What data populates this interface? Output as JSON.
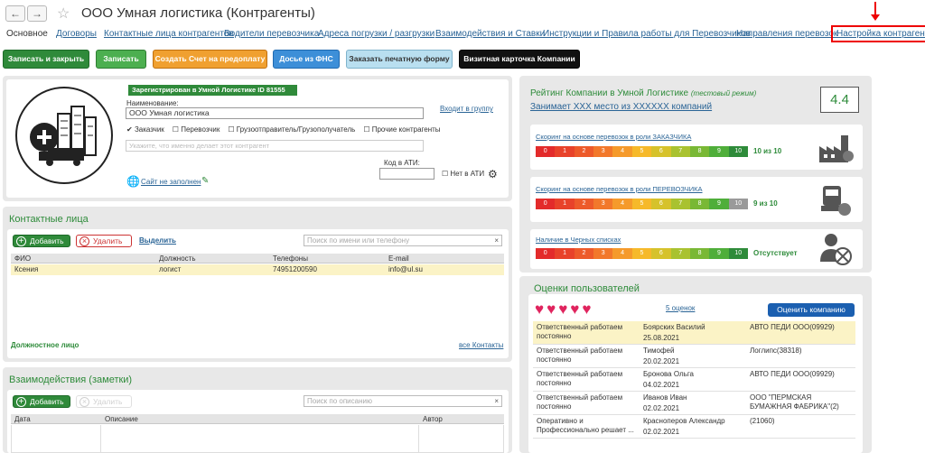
{
  "window": {
    "back": "←",
    "forward": "→",
    "star": "☆",
    "title": "ООО Умная логистика (Контрагенты)"
  },
  "tabs": [
    "Основное",
    "Договоры",
    "Контактные лица контрагентов",
    "Водители перевозчика",
    "Адреса погрузки / разгрузки",
    "Взаимодействия и Ставки",
    "Инструкции и Правила работы для Перевозчиков",
    "Направления перевозок",
    "Настройка контрагента"
  ],
  "toolbar": {
    "save_close": "Записать и закрыть",
    "save": "Записать",
    "create_invoice": "Создать Счет на предоплату",
    "fns_dossier": "Досье из ФНС",
    "print_form": "Заказать печатную форму",
    "business_card": "Визитная карточка Компании"
  },
  "company": {
    "registered": "Зарегистрирован в Умной Логистике   ID 81555",
    "name_label": "Наименование:",
    "name_value": "ООО Умная логистика",
    "join_group": "Входит в группу",
    "roles": [
      "Заказчик",
      "Перевозчик",
      "Грузоотправитель/Грузополучатель",
      "Прочие контрагенты"
    ],
    "note_placeholder": "Укажите, что именно делает этот контрагент",
    "ati_label": "Код в АТИ:",
    "no_ati": "Нет в АТИ",
    "site": "Сайт не заполнен"
  },
  "contacts": {
    "title": "Контактные лица",
    "add": "Добавить",
    "delete": "Удалить",
    "select": "Выделить",
    "search_placeholder": "Поиск по имени или телефону",
    "columns": [
      "ФИО",
      "Должность",
      "Телефоны",
      "E-mail"
    ],
    "rows": [
      {
        "name": "Ксения",
        "position": "логист",
        "phone": "74951200590",
        "email": "info@ul.su"
      }
    ],
    "footer_left": "Должностное лицо",
    "footer_right": "все Контакты"
  },
  "interactions": {
    "title": "Взаимодействия (заметки)",
    "add": "Добавить",
    "delete": "Удалить",
    "search_placeholder": "Поиск по описанию",
    "columns": [
      "Дата",
      "Описание",
      "Автор"
    ]
  },
  "rating": {
    "title": "Рейтинг Компании в Умной Логистике",
    "mode": "(тестовый режим)",
    "place": "Занимает XXX место из XXXXXX компаний",
    "score": "4.4",
    "scale": [
      "0",
      "1",
      "2",
      "3",
      "4",
      "5",
      "6",
      "7",
      "8",
      "9",
      "10"
    ],
    "blocks": [
      {
        "label": "Скоринг на основе перевозок в роли ЗАКАЗЧИКА",
        "result": "10 из 10",
        "level": 10
      },
      {
        "label": "Скоринг на основе перевозок в роли ПЕРЕВОЗЧИКА",
        "result": "9 из 10",
        "level": 9
      },
      {
        "label": "Наличие в Черных списках",
        "result": "Отсутствует",
        "level": 10
      }
    ]
  },
  "reviews": {
    "title": "Оценки пользователей",
    "count": "5 оценок",
    "rate_button": "Оценить компанию",
    "rows": [
      {
        "text": "Ответственный работаем постоянно",
        "author": "Боярских Василий",
        "date": "25.08.2021",
        "company": "АВТО ПЕДИ ООО(09929)"
      },
      {
        "text": "Ответственный работаем постоянно",
        "author": "Тимофей",
        "date": "20.02.2021",
        "company": "Логлипс(38318)"
      },
      {
        "text": "Ответственный работаем постоянно",
        "author": "Бронова Ольга",
        "date": "04.02.2021",
        "company": "АВТО ПЕДИ ООО(09929)"
      },
      {
        "text": "Ответственный работаем постоянно",
        "author": "Иванов Иван",
        "date": "02.02.2021",
        "company": "ООО \"ПЕРМСКАЯ БУМАЖНАЯ ФАБРИКА\"(2)"
      },
      {
        "text": "Оперативно и Профессионально решает ...",
        "author": "Красноперов Александр",
        "date": "02.02.2021",
        "company": "(21060)"
      }
    ]
  },
  "colors": {
    "accent_green": "#2f8a3a",
    "link_blue": "#2a6496",
    "highlight": "#fbf3c6",
    "heart": "#e0245e"
  }
}
